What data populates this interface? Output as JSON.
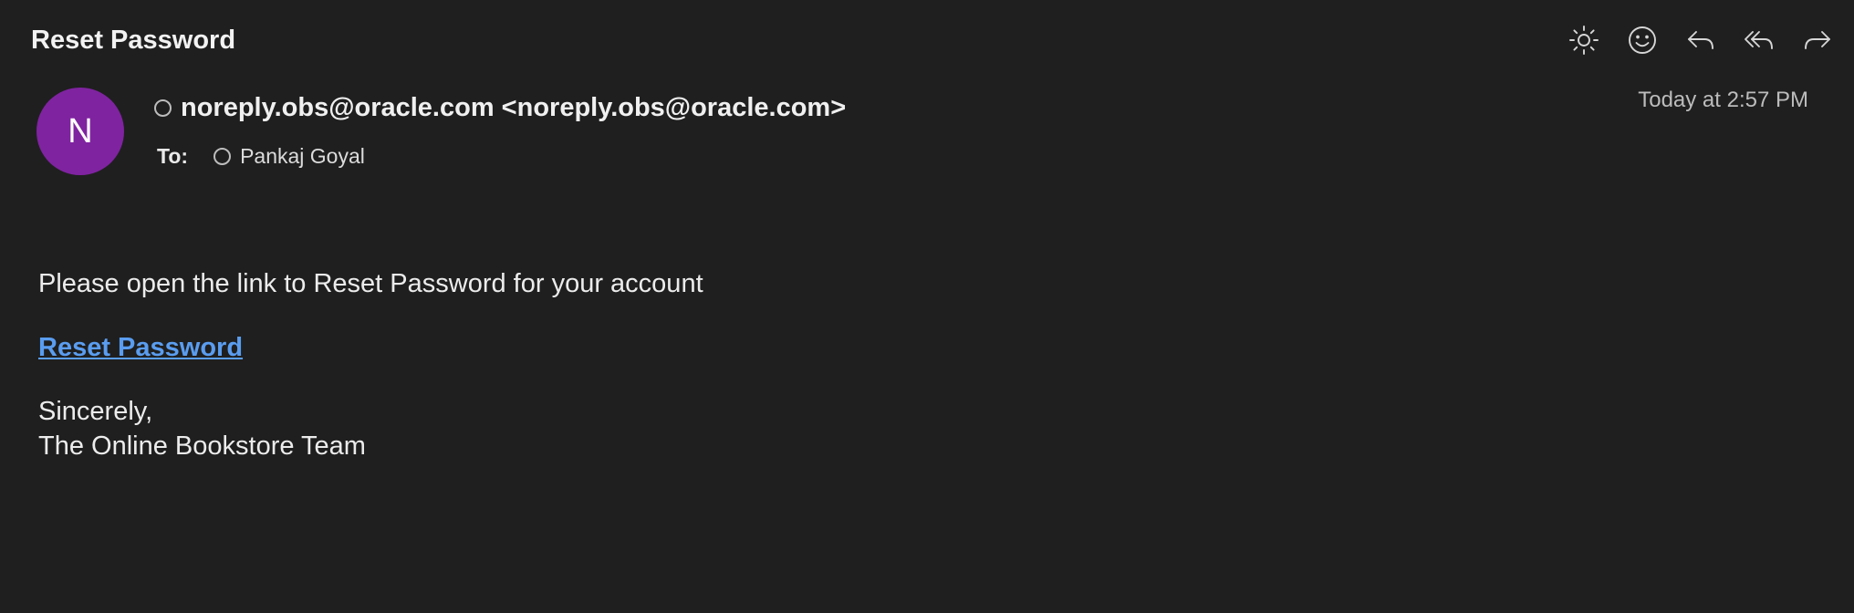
{
  "email": {
    "subject": "Reset Password",
    "sender_initial": "N",
    "sender": "noreply.obs@oracle.com <noreply.obs@oracle.com>",
    "to_label": "To:",
    "recipient": "Pankaj Goyal",
    "timestamp": "Today at 2:57 PM",
    "avatar_color": "#7f23a0"
  },
  "toolbar": {
    "icons": [
      "sun-icon",
      "emoji-icon",
      "reply-icon",
      "reply-all-icon",
      "forward-icon"
    ]
  },
  "message": {
    "intro": "Please open the link to Reset Password for your account",
    "link_text": "Reset Password",
    "link_color": "#5a9df0",
    "closing": "Sincerely,",
    "signature": "The Online Bookstore Team"
  }
}
